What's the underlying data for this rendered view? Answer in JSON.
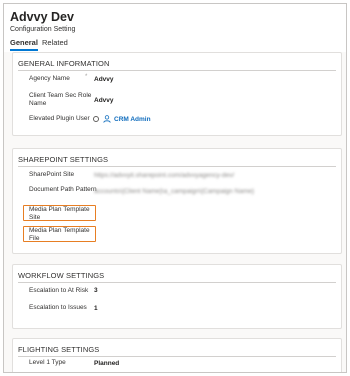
{
  "header": {
    "title": "Advvy Dev",
    "subtitle": "Configuration Setting"
  },
  "tabs": [
    {
      "label": "General",
      "selected": true
    },
    {
      "label": "Related",
      "selected": false
    }
  ],
  "general": {
    "title": "GENERAL INFORMATION",
    "agency_name_label": "Agency Name",
    "agency_name_required": "*",
    "agency_name_value": "Advvy",
    "client_team_label": "Client Team Sec Role Name",
    "client_team_value": "Advvy",
    "elevated_label": "Elevated Plugin User",
    "elevated_value": "CRM Admin"
  },
  "sharepoint": {
    "title": "SHAREPOINT SETTINGS",
    "site_label": "SharePoint Site",
    "site_value": "https://advvyit.sharepoint.com/advvyagency-dev/",
    "doc_path_label": "Document Path Pattern",
    "doc_path_value": "accounts\\{Client Name}\\a_campaign\\{Campaign Name}",
    "media_site_label": "Media Plan Template Site",
    "media_file_label": "Media Plan Template File"
  },
  "workflow": {
    "title": "WORKFLOW SETTINGS",
    "at_risk_label": "Escalation to At Risk",
    "at_risk_value": "3",
    "issues_label": "Escalation to Issues",
    "issues_value": "1"
  },
  "flighting": {
    "title": "FLIGHTING SETTINGS",
    "level1_label": "Level 1 Type",
    "level1_value": "Planned"
  },
  "colors": {
    "accent": "#0078d4",
    "link": "#0f6cbd",
    "highlight": "#e77e23"
  }
}
